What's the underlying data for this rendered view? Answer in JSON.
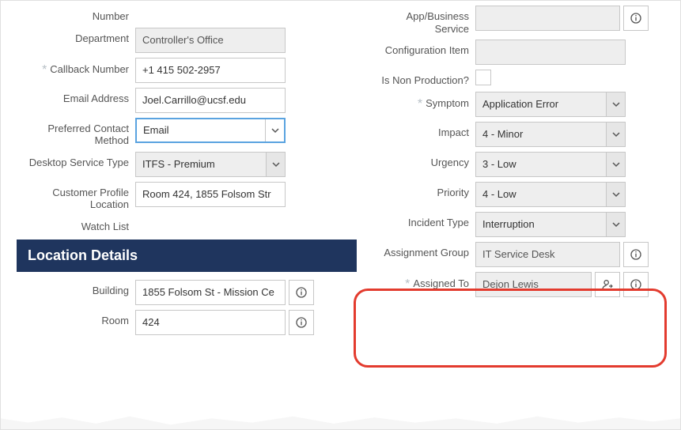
{
  "left": {
    "number_label": "Number",
    "department_label": "Department",
    "department_value": "Controller's Office",
    "callback_label": "Callback Number",
    "callback_value": "+1 415 502-2957",
    "email_label": "Email Address",
    "email_value": "Joel.Carrillo@ucsf.edu",
    "contact_label": "Preferred Contact Method",
    "contact_value": "Email",
    "desktop_label": "Desktop Service Type",
    "desktop_value": "ITFS - Premium",
    "profile_label": "Customer Profile Location",
    "profile_value": "Room 424, 1855 Folsom Str",
    "watch_label": "Watch List"
  },
  "location": {
    "header": "Location Details",
    "building_label": "Building",
    "building_value": "1855 Folsom St - Mission Ce",
    "room_label": "Room",
    "room_value": "424"
  },
  "right": {
    "app_label": "App/Business Service",
    "ci_label": "Configuration Item",
    "nonprod_label": "Is Non Production?",
    "symptom_label": "Symptom",
    "symptom_value": "Application Error",
    "impact_label": "Impact",
    "impact_value": "4 - Minor",
    "urgency_label": "Urgency",
    "urgency_value": "3 - Low",
    "priority_label": "Priority",
    "priority_value": "4 - Low",
    "incident_type_label": "Incident Type",
    "incident_type_value": "Interruption",
    "assign_group_label": "Assignment Group",
    "assign_group_value": "IT Service Desk",
    "assigned_to_label": "Assigned To",
    "assigned_to_value": "Dejon Lewis"
  }
}
